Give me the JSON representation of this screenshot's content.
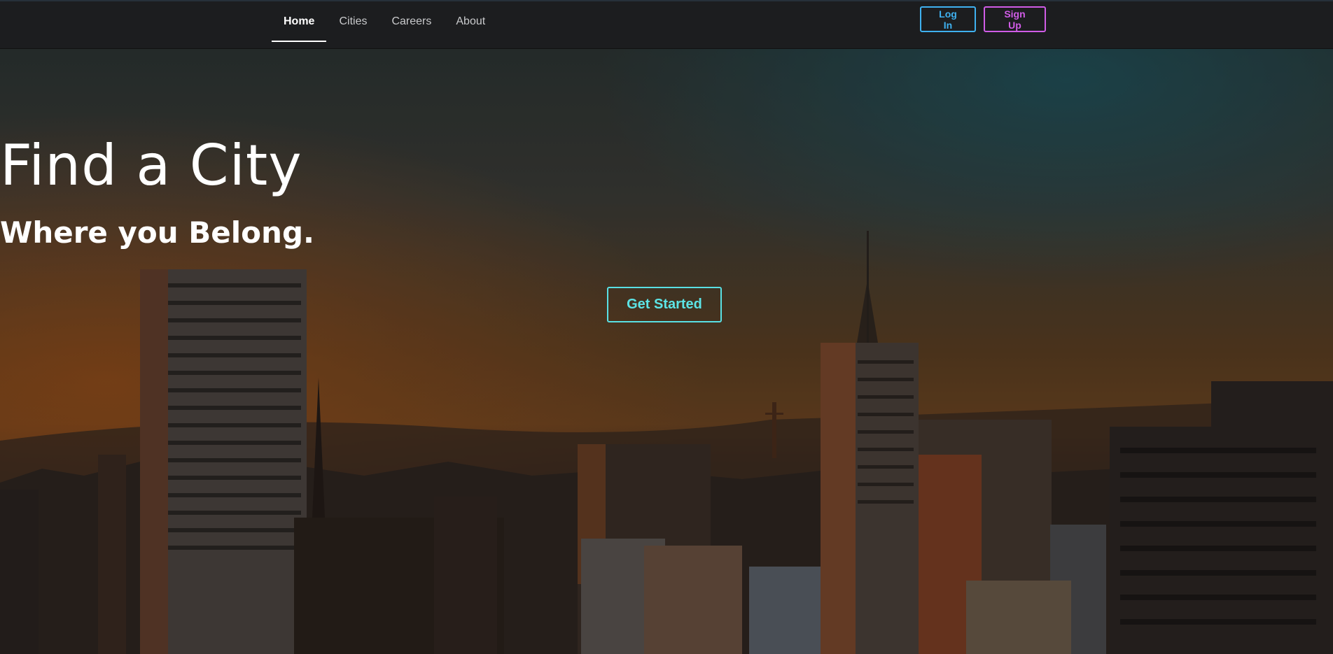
{
  "nav": {
    "links": [
      {
        "label": "Home"
      },
      {
        "label": "Cities"
      },
      {
        "label": "Careers"
      },
      {
        "label": "About"
      }
    ],
    "login_label": "Log In",
    "signup_label": "Sign Up"
  },
  "hero": {
    "title": "Find a City",
    "subtitle": "Where you Belong.",
    "cta_label": "Get Started"
  },
  "colors": {
    "nav_bg": "#1c1d1f",
    "login_accent": "#3fb1f0",
    "signup_accent": "#d05ce6",
    "cta_accent": "#5ce4e6"
  }
}
